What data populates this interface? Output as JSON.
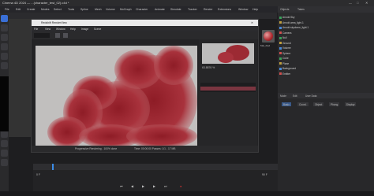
{
  "window": {
    "title": "Cinema 4D 2024 — ...(character_test_02).c4d *"
  },
  "menubar": {
    "items": [
      "File",
      "Edit",
      "Create",
      "Modes",
      "Select",
      "Tools",
      "Spline",
      "Mesh",
      "Volume",
      "MoGraph",
      "Character",
      "Animate",
      "Simulate",
      "Tracker",
      "Render",
      "Extensions",
      "Window",
      "Help"
    ]
  },
  "render_viewer": {
    "title": "Redshift RenderView",
    "menu": [
      "File",
      "View",
      "Window",
      "Help",
      "Image",
      "Scene"
    ],
    "zoom": "63.8876 %",
    "status": "Progressive Rendering - 100% done",
    "status_time": "Time: 00:00:00  Passes: 1/1 - 17 MB",
    "zoom_lower": "63.8876 %"
  },
  "object_manager": {
    "tabs": [
      "Objects",
      "Takes"
    ],
    "items": [
      "Arnold Sky",
      "Arnold area_light.1",
      "Arnold skydome_light.1",
      "Camera",
      "Null",
      "Ground",
      "Volume",
      "Sphere",
      "Cube",
      "Plane",
      "Background",
      "Emitter"
    ]
  },
  "material": {
    "name": "Mat_Red"
  },
  "attributes": {
    "tabs": [
      "Mode",
      "Edit",
      "User Data"
    ],
    "rows": [
      "Basic",
      "Coord.",
      "Object",
      "Phong",
      "Display"
    ]
  },
  "timeline": {
    "frame_start": "0 F",
    "frame_end": "90 F",
    "current": "0 F"
  }
}
